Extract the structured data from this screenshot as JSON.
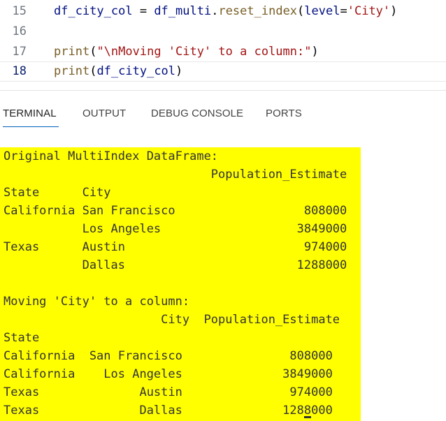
{
  "editor": {
    "lines": [
      {
        "number": "15",
        "parts": [
          {
            "cls": "v",
            "text": "df_city_col"
          },
          {
            "cls": "p",
            "text": " = "
          },
          {
            "cls": "v",
            "text": "df_multi"
          },
          {
            "cls": "p",
            "text": "."
          },
          {
            "cls": "f",
            "text": "reset_index"
          },
          {
            "cls": "p",
            "text": "("
          },
          {
            "cls": "v",
            "text": "level"
          },
          {
            "cls": "p",
            "text": "="
          },
          {
            "cls": "s",
            "text": "'City'"
          },
          {
            "cls": "p",
            "text": ")"
          }
        ]
      },
      {
        "number": "16",
        "parts": []
      },
      {
        "number": "17",
        "parts": [
          {
            "cls": "f",
            "text": "print"
          },
          {
            "cls": "p",
            "text": "("
          },
          {
            "cls": "s",
            "text": "\"\\nMoving 'City' to a column:\""
          },
          {
            "cls": "p",
            "text": ")"
          }
        ]
      },
      {
        "number": "18",
        "active": true,
        "parts": [
          {
            "cls": "f",
            "text": "print"
          },
          {
            "cls": "p",
            "text": "("
          },
          {
            "cls": "v",
            "text": "df_city_col"
          },
          {
            "cls": "p",
            "text": ")"
          }
        ]
      }
    ]
  },
  "panel": {
    "tabs": [
      "TERMINAL",
      "OUTPUT",
      "DEBUG CONSOLE",
      "PORTS"
    ],
    "active_tab": "TERMINAL"
  },
  "terminal": {
    "lines": [
      "Original MultiIndex DataFrame:",
      "                             Population_Estimate",
      "State      City",
      "California San Francisco                  808000",
      "           Los Angeles                   3849000",
      "Texas      Austin                         974000",
      "           Dallas                        1288000",
      "",
      "Moving 'City' to a column:",
      "                      City  Population_Estimate",
      "State",
      "California  San Francisco               808000",
      "California    Los Angeles              3849000",
      "Texas              Austin               974000",
      "Texas              Dallas              1288000"
    ]
  },
  "colors": {
    "terminal_highlight": "#ffff00",
    "active_tab_underline": "#005fb8"
  }
}
